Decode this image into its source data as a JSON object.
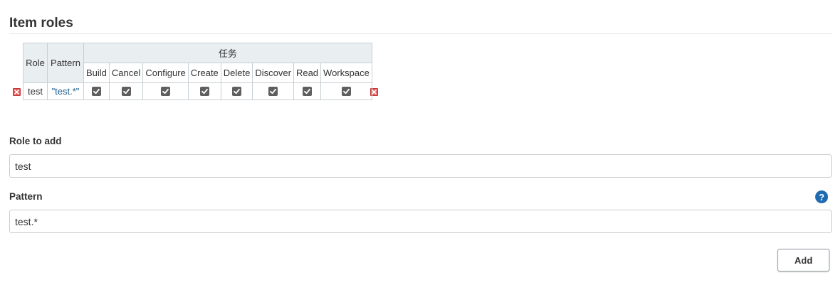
{
  "section": {
    "title": "Item roles"
  },
  "table": {
    "role_header": "Role",
    "pattern_header": "Pattern",
    "group_header": "任务",
    "permissions": [
      "Build",
      "Cancel",
      "Configure",
      "Create",
      "Delete",
      "Discover",
      "Read",
      "Workspace"
    ],
    "rows": [
      {
        "role": "test",
        "pattern": "\"test.*\"",
        "checked": [
          true,
          true,
          true,
          true,
          true,
          true,
          true,
          true
        ]
      }
    ]
  },
  "form": {
    "role_label": "Role to add",
    "role_value": "test",
    "pattern_label": "Pattern",
    "pattern_value": "test.*",
    "help_glyph": "?",
    "add_label": "Add"
  },
  "icons": {
    "delete": "delete-icon",
    "help": "help-icon",
    "checkbox": "checkbox-checked-icon"
  },
  "colors": {
    "delete_red": "#e65a5a",
    "help_blue": "#1e6bb0",
    "pattern_text": "#1f5d8c",
    "header_bg": "#e9eef1"
  }
}
